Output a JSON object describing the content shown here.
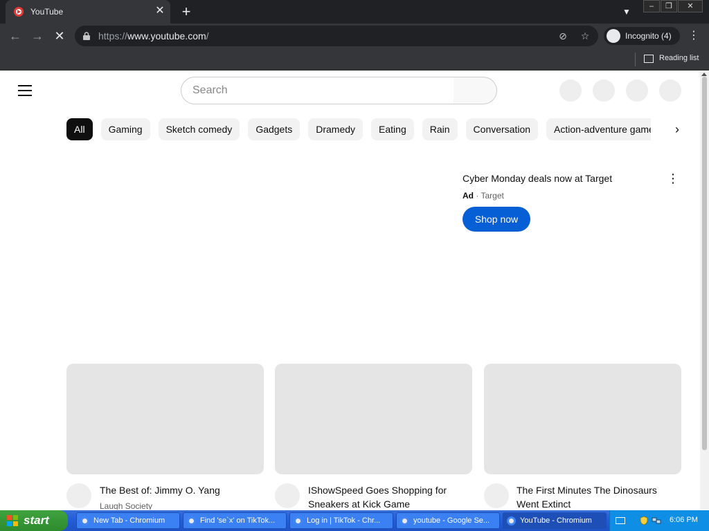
{
  "browser": {
    "tab_title": "YouTube",
    "url_prefix": "https://",
    "url_host": "www.youtube.com",
    "url_path": "/",
    "incognito_label": "Incognito (4)",
    "reading_list_label": "Reading list"
  },
  "youtube": {
    "search_placeholder": "Search",
    "chips": [
      "All",
      "Gaming",
      "Sketch comedy",
      "Gadgets",
      "Dramedy",
      "Eating",
      "Rain",
      "Conversation",
      "Action-adventure games"
    ],
    "ad": {
      "title": "Cyber Monday deals now at Target",
      "badge": "Ad",
      "separator": "·",
      "advertiser": "Target",
      "cta": "Shop now"
    },
    "videos": [
      {
        "title": "The Best of: Jimmy O. Yang",
        "channel": "Laugh Society"
      },
      {
        "title": "IShowSpeed Goes Shopping for Sneakers at Kick Game",
        "channel": ""
      },
      {
        "title": "The First Minutes The Dinosaurs Went Extinct",
        "channel": ""
      }
    ]
  },
  "taskbar": {
    "start_label": "start",
    "tasks": [
      {
        "label": "New Tab - Chromium"
      },
      {
        "label": "Find 'se`x' on TikTok..."
      },
      {
        "label": "Log in | TikTok - Chr..."
      },
      {
        "label": "youtube - Google Se..."
      },
      {
        "label": "YouTube - Chromium"
      }
    ],
    "clock": "6:06 PM"
  },
  "colors": {
    "brand_red": "#e53935",
    "primary_blue": "#065fd4",
    "chrome_dark": "#202124",
    "chrome_toolbar": "#35363a"
  }
}
